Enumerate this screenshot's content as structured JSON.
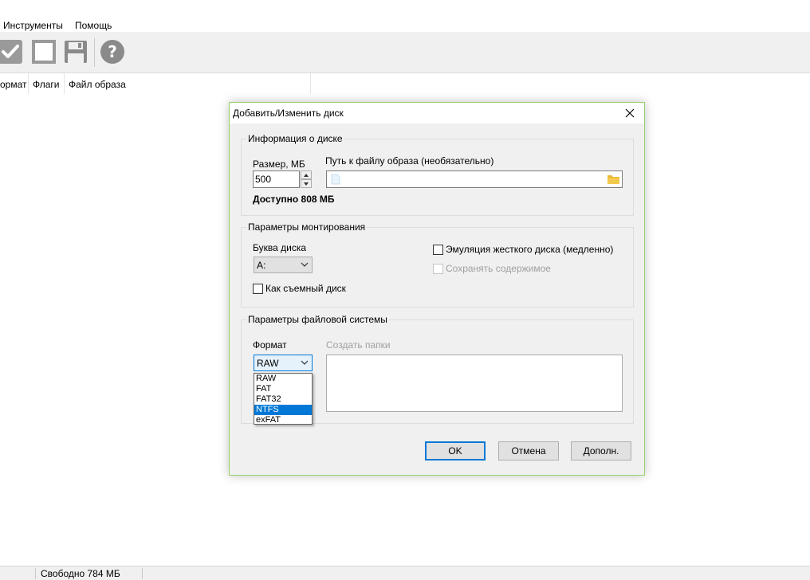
{
  "menu": {
    "tools": "Инструменты",
    "help": "Помощь"
  },
  "columns": {
    "format": "ормат",
    "flags": "Флаги",
    "image_file": "Файл образа"
  },
  "statusbar": {
    "free": "Свободно 784 МБ"
  },
  "dialog": {
    "title": "Добавить/Изменить диск",
    "disk_info": {
      "group_title": "Информация о диске",
      "size_label": "Размер, МБ",
      "size_value": "500",
      "path_label": "Путь к файлу образа (необязательно)",
      "path_value": "",
      "available": "Доступно 808 МБ"
    },
    "mount": {
      "group_title": "Параметры монтирования",
      "drive_letter_label": "Буква диска",
      "drive_letter_value": "A:",
      "removable": "Как съемный диск",
      "hdd_emulation": "Эмуляция жесткого диска (медленно)",
      "save_contents": "Сохранять содержимое"
    },
    "fs": {
      "group_title": "Параметры файловой системы",
      "format_label": "Формат",
      "format_value": "RAW",
      "create_folders_label": "Создать папки",
      "format_options": [
        "RAW",
        "FAT",
        "FAT32",
        "NTFS",
        "exFAT"
      ],
      "highlighted_option": "NTFS"
    },
    "buttons": {
      "ok": "OK",
      "cancel": "Отмена",
      "more": "Дополн."
    }
  },
  "colors": {
    "accent": "#0078d7",
    "dialog_border": "#9ad16b",
    "folder": "#e8b83a"
  }
}
